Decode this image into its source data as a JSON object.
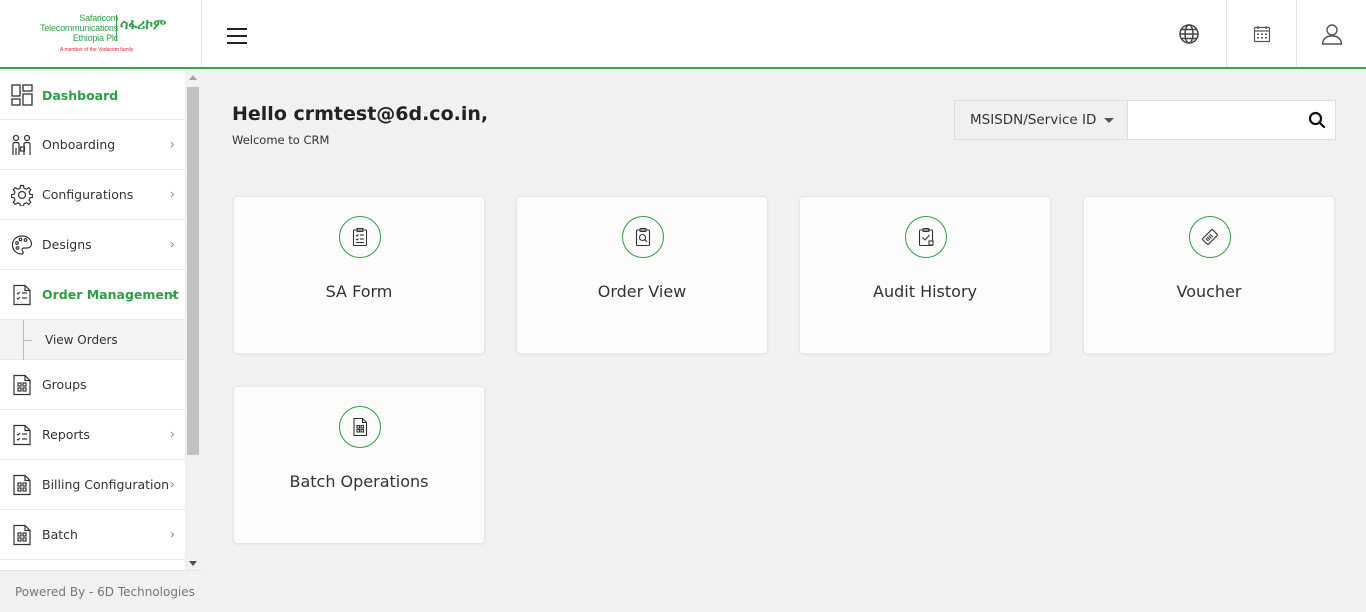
{
  "logo": {
    "line1": "Safaricom",
    "line2": "Telecommunications",
    "line3": "Ethiopia Plc",
    "amharic": "ሳፋሪኮም",
    "tagline": "A member of the Vodacom family"
  },
  "header": {
    "icons": [
      "menu-icon",
      "globe-icon",
      "calendar-icon",
      "user-icon"
    ]
  },
  "sidebar": {
    "items": [
      {
        "label": "Dashboard",
        "icon": "dashboard-icon"
      },
      {
        "label": "Onboarding",
        "icon": "onboarding-icon"
      },
      {
        "label": "Configurations",
        "icon": "gear-icon"
      },
      {
        "label": "Designs",
        "icon": "palette-icon"
      },
      {
        "label": "Order Management",
        "icon": "order-icon"
      },
      {
        "label": "View Orders"
      },
      {
        "label": "Groups",
        "icon": "groups-icon"
      },
      {
        "label": "Reports",
        "icon": "reports-icon"
      },
      {
        "label": "Billing Configuration",
        "icon": "billing-icon"
      },
      {
        "label": "Batch",
        "icon": "batch-icon"
      }
    ],
    "footer": "Powered By - 6D Technologies"
  },
  "main": {
    "greeting": "Hello crmtest@6d.co.in,",
    "welcome": "Welcome to CRM",
    "search": {
      "selected": "MSISDN/Service ID",
      "value": ""
    },
    "cards": [
      {
        "label": "SA Form",
        "icon": "clipboard-list-icon"
      },
      {
        "label": "Order View",
        "icon": "clipboard-search-icon"
      },
      {
        "label": "Audit History",
        "icon": "clipboard-check-icon"
      },
      {
        "label": "Voucher",
        "icon": "voucher-icon"
      },
      {
        "label": "Batch Operations",
        "icon": "document-grid-icon"
      }
    ]
  },
  "colors": {
    "brand": "#2e9e44",
    "background": "#f1f1f1"
  }
}
